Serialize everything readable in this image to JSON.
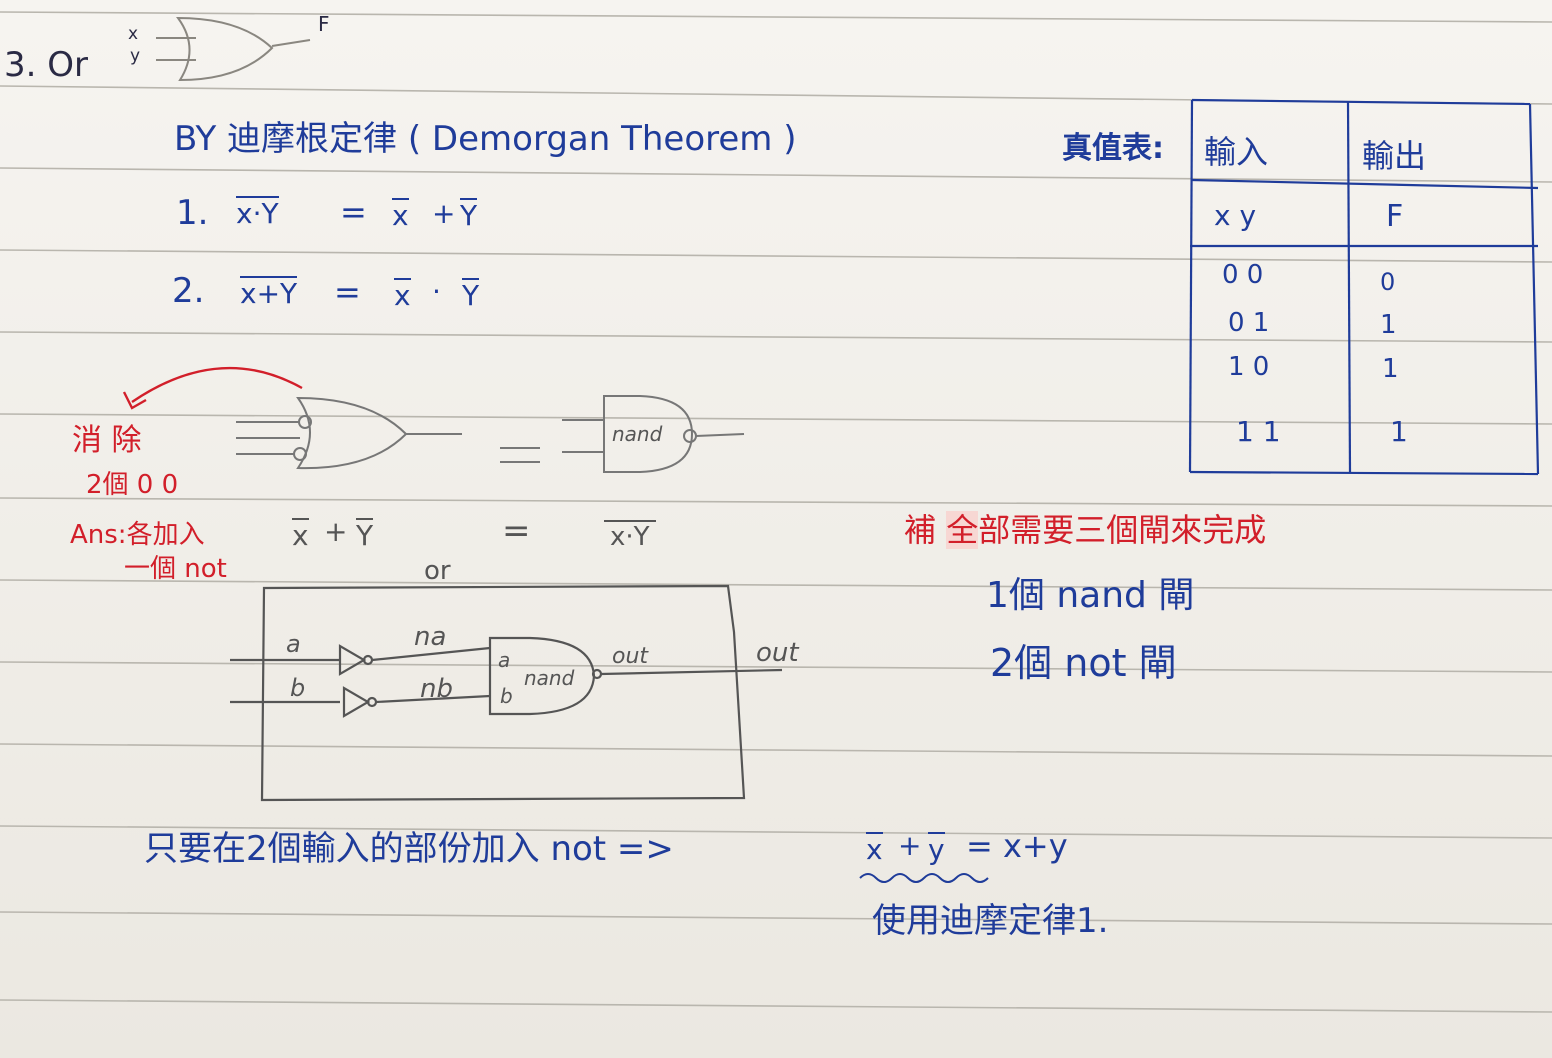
{
  "heading": {
    "number_label": "3. Or",
    "input_x": "x",
    "input_y": "y",
    "output_f": "F"
  },
  "theorem": {
    "title": "BY 迪摩根定律 ( Demorgan Theorem )",
    "law1_num": "1.",
    "law1_lhs": "x·Y",
    "law1_rhs_x": "x",
    "law1_rhs_plus": "+",
    "law1_rhs_y": "Y",
    "law2_num": "2.",
    "law2_lhs": "x+Y",
    "law2_rhs_x": "x",
    "law2_rhs_dot": "·",
    "law2_rhs_y": "Y",
    "eq": "="
  },
  "truth_table": {
    "label": "真值表:",
    "header_in": "輸入",
    "header_out": "輸出",
    "sub_in": "x y",
    "sub_out": "F",
    "rows": [
      {
        "in": "0 0",
        "out": "0"
      },
      {
        "in": "0 1",
        "out": "1"
      },
      {
        "in": "1 0",
        "out": "1"
      },
      {
        "in": "1 1",
        "out": "1"
      }
    ]
  },
  "red_note": {
    "line1": "消 除",
    "line2": "2個 0 0",
    "line3": "Ans:各加入",
    "line4": "一個 not"
  },
  "gate_eq": {
    "nand_label": "nand",
    "eq": "=",
    "expr_left_x": "x",
    "expr_left_plus": "+",
    "expr_left_y": "Y",
    "expr_right": "x·Y"
  },
  "circuit": {
    "title": "or",
    "in_a": "a",
    "in_b": "b",
    "wire_na": "na",
    "wire_nb": "nb",
    "nand_a": "a",
    "nand_b": "b",
    "nand_label": "nand",
    "wire_out": "out",
    "pin_out": "out"
  },
  "supplement": {
    "prefix": "補 ",
    "highlight": "全",
    "rest": "部需要三個閘來完成",
    "line1": "1個 nand 閘",
    "line2": "2個 not 閘"
  },
  "bottom": {
    "sentence": "只要在2個輸入的部份加入 not =>",
    "expr_x": "x",
    "expr_plus": "+",
    "expr_y": "y",
    "expr_rhs": "= x+y",
    "note": "使用迪摩定律1."
  },
  "colors": {
    "paper": "#f4f2ee",
    "rule": "#b9b6ae",
    "blue_ink": "#1f3c9a",
    "red_ink": "#d21f2a",
    "pencil": "#555555"
  }
}
